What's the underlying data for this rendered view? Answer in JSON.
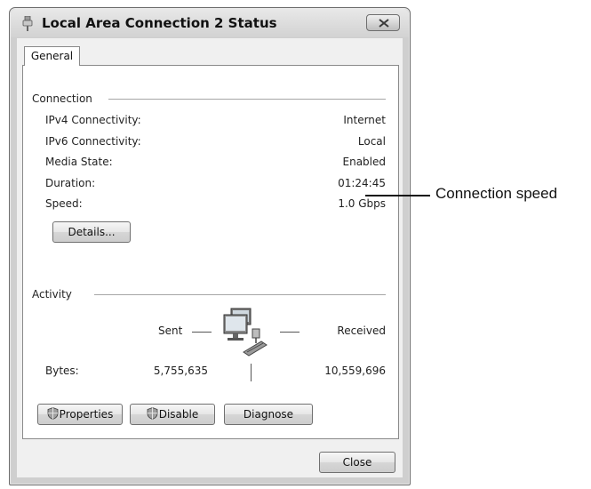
{
  "window": {
    "title": "Local Area Connection 2 Status",
    "icon": "network-cable-icon",
    "close_icon": "close-icon"
  },
  "tabs": [
    {
      "label": "General",
      "selected": true
    }
  ],
  "connection": {
    "heading": "Connection",
    "rows": [
      {
        "label": "IPv4 Connectivity:",
        "value": "Internet"
      },
      {
        "label": "IPv6 Connectivity:",
        "value": "Local"
      },
      {
        "label": "Media State:",
        "value": "Enabled"
      },
      {
        "label": "Duration:",
        "value": "01:24:45"
      },
      {
        "label": "Speed:",
        "value": "1.0 Gbps"
      }
    ],
    "details_button": "Details..."
  },
  "activity": {
    "heading": "Activity",
    "sent_label": "Sent",
    "received_label": "Received",
    "bytes_label": "Bytes:",
    "bytes_sent": "5,755,635",
    "bytes_received": "10,559,696",
    "network_icon": "network-computers-icon"
  },
  "buttons": {
    "properties": "Properties",
    "disable": "Disable",
    "diagnose": "Diagnose",
    "close": "Close",
    "shield_icon": "uac-shield-icon"
  },
  "annotation": {
    "label": "Connection speed"
  },
  "colors": {
    "window_frame": "#cfcfcf",
    "panel": "#ffffff",
    "dialog_bg": "#f0f0f0"
  }
}
